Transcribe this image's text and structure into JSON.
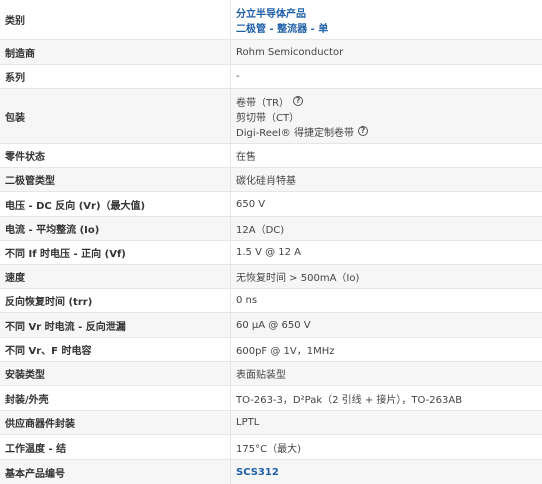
{
  "rows": [
    {
      "label": "类别",
      "value_lines": [
        "分立半导体产品",
        "二极管 - 整流器 - 单"
      ]
    },
    {
      "label": "制造商",
      "value": "Rohm Semiconductor"
    },
    {
      "label": "系列",
      "value": "-"
    },
    {
      "label": "包装",
      "packaging": [
        "卷带（TR）",
        "剪切带（CT）",
        "Digi-Reel® 得捷定制卷带"
      ],
      "help_icon": "question-circle-icon"
    },
    {
      "label": "零件状态",
      "value": "在售"
    },
    {
      "label": "二极管类型",
      "value": "碳化硅肖特基"
    },
    {
      "label": "电压 - DC 反向 (Vr)（最大值)",
      "value": "650 V"
    },
    {
      "label": "电流 - 平均整流 (Io)",
      "value": "12A（DC)"
    },
    {
      "label": "不同 If 时电压 - 正向 (Vf)",
      "value": "1.5 V @ 12 A"
    },
    {
      "label": "速度",
      "value": "无恢复时间 > 500mA（Io)"
    },
    {
      "label": "反向恢复时间 (trr)",
      "value": "0 ns"
    },
    {
      "label": "不同 Vr 时电流 - 反向泄漏",
      "value": "60 µA @ 650 V"
    },
    {
      "label": "不同 Vr、F 时电容",
      "value": "600pF @ 1V，1MHz"
    },
    {
      "label": "安装类型",
      "value": "表面贴装型"
    },
    {
      "label": "封装/外壳",
      "value": "TO-263-3，D²Pak（2 引线 + 接片），TO-263AB"
    },
    {
      "label": "供应商器件封装",
      "value": "LPTL"
    },
    {
      "label": "工作温度 - 结",
      "value": "175°C（最大)"
    },
    {
      "label": "基本产品编号",
      "value": "SCS312"
    }
  ],
  "colors": {
    "link": "#1f5fa8",
    "alt_row": "#f6f6f6",
    "border": "#e6e6e6"
  }
}
